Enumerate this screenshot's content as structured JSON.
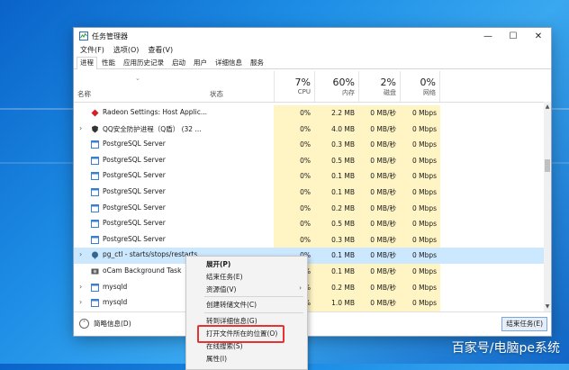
{
  "window": {
    "title": "任务管理器",
    "controls": {
      "minimize": "—",
      "maximize": "☐",
      "close": "✕"
    }
  },
  "menu": [
    "文件(F)",
    "选项(O)",
    "查看(V)"
  ],
  "tabs": [
    "进程",
    "性能",
    "应用历史记录",
    "启动",
    "用户",
    "详细信息",
    "服务"
  ],
  "active_tab": "进程",
  "header": {
    "name": "名称",
    "status": "状态",
    "cpu": {
      "pct": "7%",
      "label": "CPU"
    },
    "memory": {
      "pct": "60%",
      "label": "内存"
    },
    "disk": {
      "pct": "2%",
      "label": "磁盘"
    },
    "network": {
      "pct": "0%",
      "label": "网络"
    }
  },
  "rows": [
    {
      "name": "Radeon Settings: Host Applic...",
      "cpu": "0%",
      "mem": "2.2 MB",
      "disk": "0 MB/秒",
      "net": "0 Mbps",
      "expand": false,
      "icon": "radeon-icon"
    },
    {
      "name": "QQ安全防护进程（Q盾） (32 ...",
      "cpu": "0%",
      "mem": "4.0 MB",
      "disk": "0 MB/秒",
      "net": "0 Mbps",
      "expand": true,
      "icon": "shield-app-icon"
    },
    {
      "name": "PostgreSQL Server",
      "cpu": "0%",
      "mem": "0.3 MB",
      "disk": "0 MB/秒",
      "net": "0 Mbps",
      "expand": false,
      "icon": "window-app-icon"
    },
    {
      "name": "PostgreSQL Server",
      "cpu": "0%",
      "mem": "0.5 MB",
      "disk": "0 MB/秒",
      "net": "0 Mbps",
      "expand": false,
      "icon": "window-app-icon"
    },
    {
      "name": "PostgreSQL Server",
      "cpu": "0%",
      "mem": "0.1 MB",
      "disk": "0 MB/秒",
      "net": "0 Mbps",
      "expand": false,
      "icon": "window-app-icon"
    },
    {
      "name": "PostgreSQL Server",
      "cpu": "0%",
      "mem": "0.1 MB",
      "disk": "0 MB/秒",
      "net": "0 Mbps",
      "expand": false,
      "icon": "window-app-icon"
    },
    {
      "name": "PostgreSQL Server",
      "cpu": "0%",
      "mem": "0.2 MB",
      "disk": "0 MB/秒",
      "net": "0 Mbps",
      "expand": false,
      "icon": "window-app-icon"
    },
    {
      "name": "PostgreSQL Server",
      "cpu": "0%",
      "mem": "0.5 MB",
      "disk": "0 MB/秒",
      "net": "0 Mbps",
      "expand": false,
      "icon": "window-app-icon"
    },
    {
      "name": "PostgreSQL Server",
      "cpu": "0%",
      "mem": "0.3 MB",
      "disk": "0 MB/秒",
      "net": "0 Mbps",
      "expand": false,
      "icon": "window-app-icon"
    },
    {
      "name": "pg_ctl - starts/stops/restarts",
      "cpu": "0%",
      "mem": "0.1 MB",
      "disk": "0 MB/秒",
      "net": "0 Mbps",
      "expand": true,
      "icon": "elephant-icon",
      "selected": true
    },
    {
      "name": "oCam Background Task",
      "cpu": "0%",
      "mem": "0.1 MB",
      "disk": "0 MB/秒",
      "net": "0 Mbps",
      "expand": false,
      "icon": "ocam-icon"
    },
    {
      "name": "mysqld",
      "cpu": "0%",
      "mem": "0.2 MB",
      "disk": "0 MB/秒",
      "net": "0 Mbps",
      "expand": true,
      "icon": "window-app-icon"
    },
    {
      "name": "mysqld",
      "cpu": "0%",
      "mem": "1.0 MB",
      "disk": "0 MB/秒",
      "net": "0 Mbps",
      "expand": true,
      "icon": "window-app-icon"
    }
  ],
  "context_menu": [
    {
      "label": "展开(P)",
      "bold": true
    },
    {
      "label": "结束任务(E)"
    },
    {
      "label": "资源值(V)",
      "submenu": true
    },
    {
      "label": "创建转储文件(C)"
    },
    {
      "label": "转到详细信息(G)"
    },
    {
      "label": "打开文件所在的位置(O)",
      "highlighted": true
    },
    {
      "label": "在线搜索(S)"
    },
    {
      "label": "属性(I)"
    }
  ],
  "footer": {
    "fewer_details": "简略信息(D)",
    "end_task": "结束任务(E)"
  },
  "watermark": "百家号/电脑pe系统",
  "colors": {
    "selected_row": "#cce8ff",
    "resource_column": "#fff4c4",
    "highlight": "#e53232"
  }
}
